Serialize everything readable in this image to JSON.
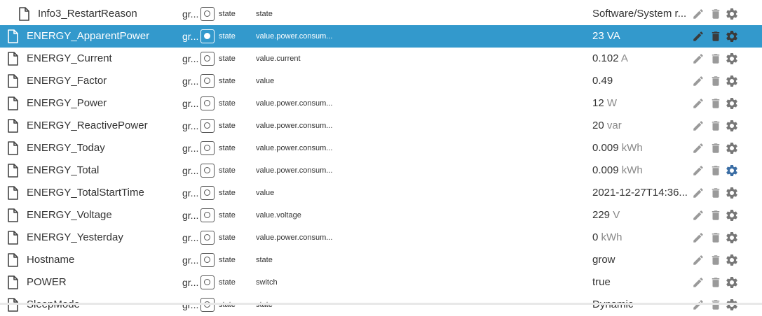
{
  "rows": [
    {
      "name": "Info3_RestartReason",
      "group": "gr...",
      "type": "state",
      "role": "state",
      "value": "Software/System r...",
      "unit": "",
      "indent": true,
      "selected": false,
      "gear_color": "#777777"
    },
    {
      "name": "ENERGY_ApparentPower",
      "group": "gr...",
      "type": "state",
      "role": "value.power.consum...",
      "value": "23",
      "unit": "VA",
      "indent": false,
      "selected": true,
      "gear_color": "#555555"
    },
    {
      "name": "ENERGY_Current",
      "group": "gr...",
      "type": "state",
      "role": "value.current",
      "value": "0.102",
      "unit": "A",
      "indent": false,
      "selected": false,
      "gear_color": "#777777"
    },
    {
      "name": "ENERGY_Factor",
      "group": "gr...",
      "type": "state",
      "role": "value",
      "value": "0.49",
      "unit": "",
      "indent": false,
      "selected": false,
      "gear_color": "#777777"
    },
    {
      "name": "ENERGY_Power",
      "group": "gr...",
      "type": "state",
      "role": "value.power.consum...",
      "value": "12",
      "unit": "W",
      "indent": false,
      "selected": false,
      "gear_color": "#777777"
    },
    {
      "name": "ENERGY_ReactivePower",
      "group": "gr...",
      "type": "state",
      "role": "value.power.consum...",
      "value": "20",
      "unit": "var",
      "indent": false,
      "selected": false,
      "gear_color": "#777777"
    },
    {
      "name": "ENERGY_Today",
      "group": "gr...",
      "type": "state",
      "role": "value.power.consum...",
      "value": "0.009",
      "unit": "kWh",
      "indent": false,
      "selected": false,
      "gear_color": "#777777"
    },
    {
      "name": "ENERGY_Total",
      "group": "gr...",
      "type": "state",
      "role": "value.power.consum...",
      "value": "0.009",
      "unit": "kWh",
      "indent": false,
      "selected": false,
      "gear_color": "#3b6ea5"
    },
    {
      "name": "ENERGY_TotalStartTime",
      "group": "gr...",
      "type": "state",
      "role": "value",
      "value": "2021-12-27T14:36...",
      "unit": "",
      "indent": false,
      "selected": false,
      "gear_color": "#777777"
    },
    {
      "name": "ENERGY_Voltage",
      "group": "gr...",
      "type": "state",
      "role": "value.voltage",
      "value": "229",
      "unit": "V",
      "indent": false,
      "selected": false,
      "gear_color": "#777777"
    },
    {
      "name": "ENERGY_Yesterday",
      "group": "gr...",
      "type": "state",
      "role": "value.power.consum...",
      "value": "0",
      "unit": "kWh",
      "indent": false,
      "selected": false,
      "gear_color": "#777777"
    },
    {
      "name": "Hostname",
      "group": "gr...",
      "type": "state",
      "role": "state",
      "value": "grow",
      "unit": "",
      "indent": false,
      "selected": false,
      "gear_color": "#777777"
    },
    {
      "name": "POWER",
      "group": "gr...",
      "type": "state",
      "role": "switch",
      "value": "true",
      "unit": "",
      "indent": false,
      "selected": false,
      "gear_color": "#777777"
    },
    {
      "name": "SleepMode",
      "group": "gr...",
      "type": "state",
      "role": "state",
      "value": "Dynamic",
      "unit": "",
      "indent": false,
      "selected": false,
      "gear_color": "#777777"
    }
  ],
  "icons": {
    "file": "file-icon",
    "edit": "pencil-icon",
    "delete": "trash-icon",
    "settings": "gear-icon",
    "type": "state-type-icon"
  }
}
